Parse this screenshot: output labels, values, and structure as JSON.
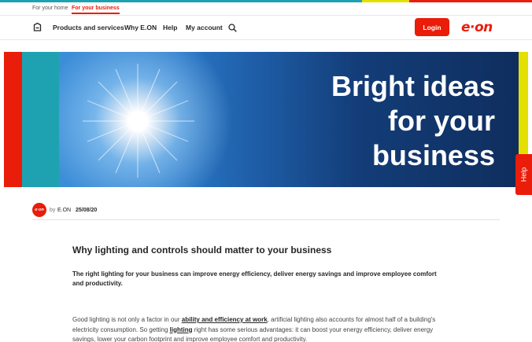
{
  "segments": {
    "home": "For your home",
    "business": "For your business"
  },
  "nav": {
    "products": "Products and services",
    "why": "Why E.ON",
    "help": "Help",
    "account": "My account",
    "login": "Login",
    "logo": "e·on"
  },
  "hero": {
    "line1": "Bright ideas",
    "line2": "for your",
    "line3": "business"
  },
  "help_tab": "Help",
  "author": {
    "avatar": "e·on",
    "by": "by",
    "name": "E.ON",
    "date": "25/08/20"
  },
  "article": {
    "heading": "Why lighting and controls should matter to your business",
    "lead": "The right lighting for your business can improve energy efficiency, deliver energy savings and improve employee comfort and productivity.",
    "body_1": "Good lighting is not only a factor in our ",
    "link_1": "ability and efficiency at work",
    "body_2": ", artificial lighting also accounts for almost half of a building's electricity consumption. So getting ",
    "link_2": "lighting",
    "body_3": " right has some serious advantages: it can boost your energy efficiency, deliver energy savings, lower your carbon footprint and improve employee comfort and productivity."
  },
  "colors": {
    "brand_red": "#ea1c0a",
    "teal": "#1ea2b1",
    "yellow": "#e3e000"
  }
}
